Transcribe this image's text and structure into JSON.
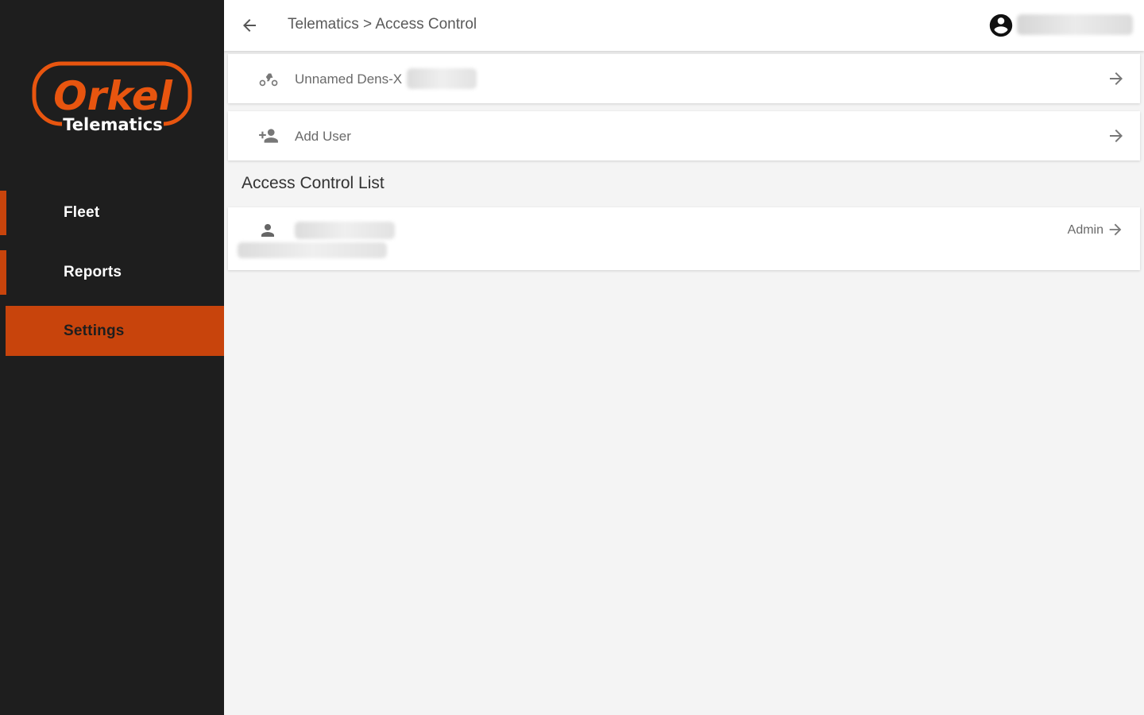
{
  "logo": {
    "brand": "Orkel",
    "sub": "Telematics"
  },
  "sidebar": {
    "items": [
      {
        "label": "Fleet"
      },
      {
        "label": "Reports"
      },
      {
        "label": "Settings"
      }
    ]
  },
  "header": {
    "breadcrumb": "Telematics > Access Control"
  },
  "device_card": {
    "label": "Unnamed Dens-X"
  },
  "add_user_card": {
    "label": "Add User"
  },
  "acl": {
    "title": "Access Control List",
    "entries": [
      {
        "role": "Admin"
      }
    ]
  },
  "colors": {
    "accent": "#c8440c",
    "sidebar_bg": "#1e1e1e",
    "content_bg": "#f4f4f4"
  },
  "icons": [
    "back-arrow-icon",
    "account-circle-icon",
    "bike-icon",
    "person-add-icon",
    "person-icon",
    "arrow-forward-icon"
  ]
}
